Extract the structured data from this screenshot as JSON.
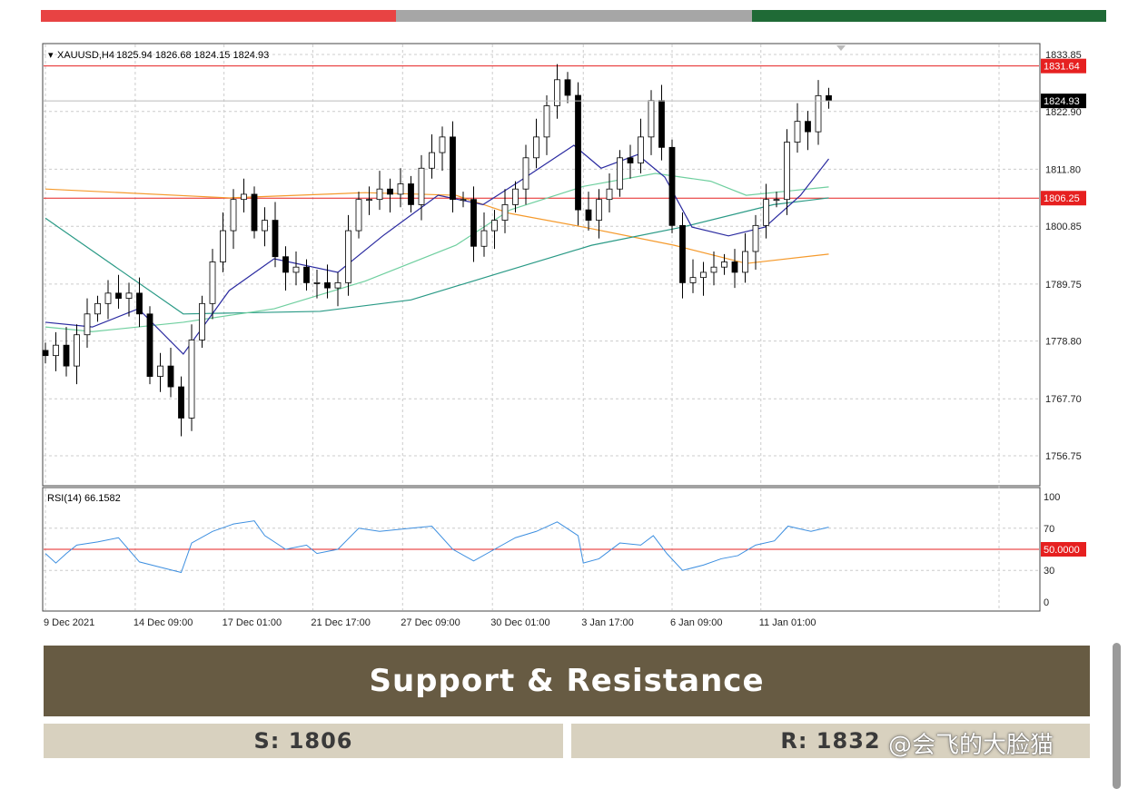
{
  "top_bar_colors": [
    "#e84343",
    "#a6a6a6",
    "#1f6a36"
  ],
  "chart_data": {
    "type": "candlestick",
    "title": "XAUUSD,H4",
    "ohlc_label": "1825.94 1826.68 1824.15 1824.93",
    "ylim": [
      1752,
      1836
    ],
    "y_ticks": [
      "1833.85",
      "1822.90",
      "1811.80",
      "1800.85",
      "1789.75",
      "1778.80",
      "1767.70",
      "1756.75"
    ],
    "x_ticks": [
      "9 Dec 2021",
      "14 Dec 09:00",
      "17 Dec 01:00",
      "21 Dec 17:00",
      "27 Dec 09:00",
      "30 Dec 01:00",
      "3 Jan 17:00",
      "6 Jan 09:00",
      "11 Jan 01:00"
    ],
    "x_tick_candle_index": [
      0,
      8.6,
      17.1,
      25.6,
      34.2,
      42.8,
      51.5,
      60,
      68.5
    ],
    "closes": [
      1776,
      1778,
      1774,
      1780,
      1784,
      1786,
      1788,
      1787,
      1788,
      1784,
      1772,
      1774,
      1770,
      1764,
      1779,
      1786,
      1794,
      1800,
      1806,
      1807,
      1800,
      1802,
      1795,
      1792,
      1793,
      1790,
      1790,
      1789,
      1790,
      1800,
      1806,
      1806,
      1808,
      1807,
      1809,
      1805,
      1812,
      1815,
      1818,
      1806,
      1806,
      1797,
      1800,
      1802,
      1805,
      1808,
      1814,
      1818,
      1824,
      1829,
      1826,
      1804,
      1802,
      1806,
      1808,
      1814,
      1813,
      1818,
      1825,
      1816,
      1801,
      1790,
      1791,
      1792,
      1793,
      1794,
      1792,
      1796,
      1801,
      1806,
      1806,
      1817,
      1821,
      1819,
      1825.94,
      1824.93
    ],
    "last_price": "1824.93",
    "levels": [
      {
        "label": "1831.64",
        "value": 1831.64,
        "color": "#e62020"
      },
      {
        "label": "1806.25",
        "value": 1806.25,
        "color": "#e62020"
      }
    ],
    "moving_averages": [
      {
        "color": "#f59a2c",
        "points": [
          [
            0,
            1808
          ],
          [
            17.6,
            1806.3
          ],
          [
            30.6,
            1807.3
          ],
          [
            39.3,
            1806.8
          ],
          [
            44.5,
            1803.3
          ],
          [
            51.5,
            1800.7
          ],
          [
            60.2,
            1797.2
          ],
          [
            67.1,
            1793.7
          ],
          [
            75,
            1795.5
          ]
        ]
      },
      {
        "color": "#2a9a86",
        "points": [
          [
            0,
            1802.4
          ],
          [
            13.2,
            1784
          ],
          [
            26.3,
            1784.5
          ],
          [
            35,
            1786.7
          ],
          [
            43.7,
            1792
          ],
          [
            52.3,
            1797.2
          ],
          [
            61,
            1800.7
          ],
          [
            69.7,
            1805
          ],
          [
            75,
            1806.3
          ]
        ]
      },
      {
        "color": "#6fcf9f",
        "points": [
          [
            0,
            1781.5
          ],
          [
            4.5,
            1780.6
          ],
          [
            13.2,
            1782.4
          ],
          [
            21.9,
            1785
          ],
          [
            30.6,
            1790.3
          ],
          [
            39.3,
            1797.2
          ],
          [
            44.5,
            1804
          ],
          [
            51.5,
            1808.5
          ],
          [
            58.4,
            1811
          ],
          [
            63.7,
            1809.5
          ],
          [
            67.1,
            1806.8
          ],
          [
            71.5,
            1807.7
          ],
          [
            75,
            1808.4
          ]
        ]
      },
      {
        "color": "#2a2aa0",
        "points": [
          [
            0,
            1782.4
          ],
          [
            4.5,
            1781.5
          ],
          [
            8.9,
            1785
          ],
          [
            13.2,
            1776.3
          ],
          [
            17.6,
            1788.5
          ],
          [
            21.9,
            1794.6
          ],
          [
            28,
            1792
          ],
          [
            32.3,
            1799
          ],
          [
            37.6,
            1806.8
          ],
          [
            41.9,
            1805
          ],
          [
            45.4,
            1809.5
          ],
          [
            50.6,
            1816.4
          ],
          [
            53.2,
            1812
          ],
          [
            56.7,
            1814.6
          ],
          [
            59.3,
            1810.3
          ],
          [
            61.9,
            1800.7
          ],
          [
            65.4,
            1799
          ],
          [
            68.9,
            1800.7
          ],
          [
            72.3,
            1806.8
          ],
          [
            75,
            1813.8
          ]
        ]
      }
    ],
    "rsi": {
      "label": "RSI(14) 66.1582",
      "level_label": "50.0000",
      "level": 50,
      "ticks": [
        "100",
        "70",
        "30",
        "0"
      ],
      "tick_values": [
        100,
        70,
        30,
        0
      ],
      "points": [
        [
          0,
          46
        ],
        [
          1,
          37
        ],
        [
          2,
          46
        ],
        [
          3,
          54
        ],
        [
          5,
          57
        ],
        [
          7,
          61
        ],
        [
          9,
          38
        ],
        [
          11,
          33
        ],
        [
          13,
          28
        ],
        [
          14,
          56
        ],
        [
          16,
          67
        ],
        [
          18,
          74
        ],
        [
          20,
          77
        ],
        [
          21,
          63
        ],
        [
          23,
          50
        ],
        [
          25,
          54
        ],
        [
          26,
          46
        ],
        [
          28,
          50
        ],
        [
          30,
          70
        ],
        [
          32,
          67
        ],
        [
          35,
          70
        ],
        [
          37,
          72
        ],
        [
          39,
          50
        ],
        [
          41,
          39
        ],
        [
          43,
          50
        ],
        [
          45,
          61
        ],
        [
          47,
          67
        ],
        [
          49,
          76
        ],
        [
          51,
          63
        ],
        [
          51.5,
          37
        ],
        [
          53,
          41
        ],
        [
          55,
          56
        ],
        [
          57,
          54
        ],
        [
          58.2,
          63
        ],
        [
          59.5,
          46
        ],
        [
          61,
          30
        ],
        [
          63,
          35
        ],
        [
          64.7,
          41
        ],
        [
          66.3,
          44
        ],
        [
          68,
          54
        ],
        [
          69.8,
          58
        ],
        [
          71.1,
          72
        ],
        [
          73.3,
          67
        ],
        [
          75,
          71
        ]
      ]
    }
  },
  "banner": {
    "title": "Support & Resistance"
  },
  "support": {
    "label": "S: 1806"
  },
  "resistance": {
    "label": "R: 1832"
  },
  "watermark": {
    "text": "@会飞的大脸猫"
  }
}
